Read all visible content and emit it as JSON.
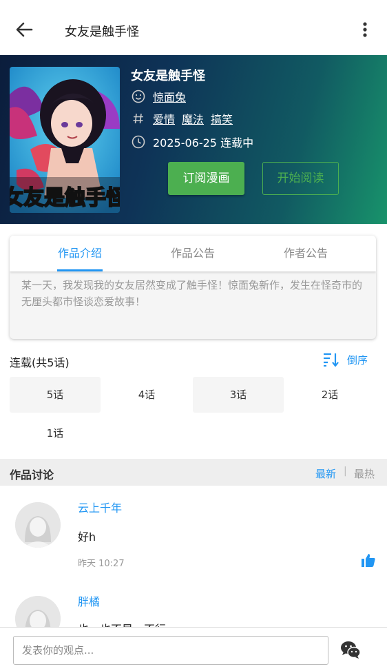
{
  "appbar": {
    "title": "女友是触手怪",
    "back_icon": "arrow-left-icon",
    "more_icon": "more-vert-icon"
  },
  "hero": {
    "title": "女友是触手怪",
    "author": "惊面兔",
    "tags": [
      "爱情",
      "魔法",
      "搞笑"
    ],
    "date_status": "2025-06-25 连载中",
    "subscribe_label": "订阅漫画",
    "read_label": "开始阅读",
    "cover_text": "女友是触手怪",
    "accent": "#4caf50"
  },
  "tabs": {
    "items": [
      "作品介绍",
      "作品公告",
      "作者公告"
    ],
    "active": 0,
    "intro": "某一天，我发现我的女友居然变成了触手怪！惊面兔新作，发生在怪奇市的无厘头都市怪谈恋爱故事！"
  },
  "chapters": {
    "heading": "连载(共5话)",
    "sort_label": "倒序",
    "items": [
      "5话",
      "4话",
      "3话",
      "2话",
      "1话"
    ]
  },
  "discussion": {
    "title": "作品讨论",
    "sort_new": "最新",
    "separator": "|",
    "sort_hot": "最热",
    "comments": [
      {
        "user": "云上千年",
        "text": "好h",
        "time": "昨天 10:27"
      },
      {
        "user": "胖橘",
        "text": "也，也不是，不行"
      }
    ]
  },
  "composer": {
    "placeholder": "发表你的观点..."
  }
}
